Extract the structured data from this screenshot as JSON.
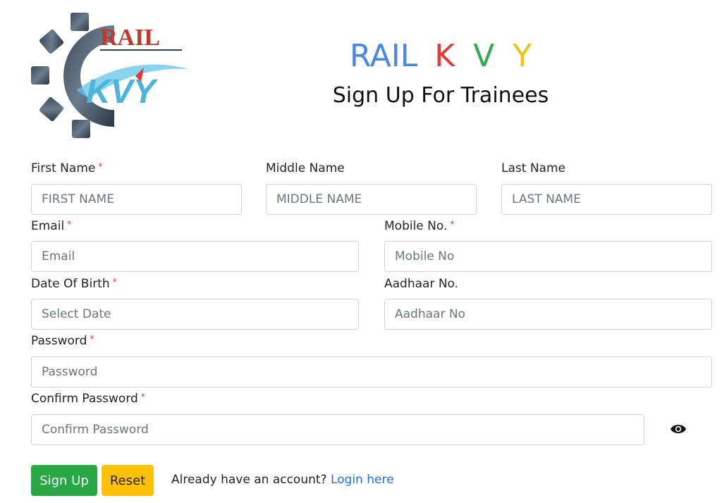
{
  "logo": {
    "top_text": "RAIL",
    "bottom_text": "KVY"
  },
  "header": {
    "brand_rail": "RAIL",
    "brand_k": "K",
    "brand_v": "V",
    "brand_y": "Y",
    "subtitle": "Sign Up For Trainees"
  },
  "colors": {
    "rail": "#4a86e8",
    "k": "#e53935",
    "v": "#34a853",
    "y": "#f4c20d",
    "required": "#dc3545",
    "signup_button": "#28a745",
    "reset_button": "#ffc107",
    "link": "#1a73e8"
  },
  "form": {
    "first_name": {
      "label": "First Name",
      "required_mark": "*",
      "placeholder": "FIRST NAME"
    },
    "middle_name": {
      "label": "Middle Name",
      "placeholder": "MIDDLE NAME"
    },
    "last_name": {
      "label": "Last Name",
      "placeholder": "LAST NAME"
    },
    "email": {
      "label": "Email",
      "required_mark": "*",
      "placeholder": "Email"
    },
    "mobile": {
      "label": "Mobile No.",
      "required_mark": "*",
      "placeholder": "Mobile No"
    },
    "dob": {
      "label": "Date Of Birth",
      "required_mark": "*",
      "placeholder": "Select Date"
    },
    "aadhaar": {
      "label": "Aadhaar No.",
      "placeholder": "Aadhaar No"
    },
    "password": {
      "label": "Password",
      "required_mark": "*",
      "placeholder": "Password"
    },
    "confirm_password": {
      "label": "Confirm Password",
      "required_mark": "*",
      "placeholder": "Confirm Password",
      "toggle_icon": "eye-icon"
    }
  },
  "actions": {
    "signup_label": "Sign Up",
    "reset_label": "Reset",
    "account_prompt": "Already have an account?",
    "login_link": "Login here"
  }
}
